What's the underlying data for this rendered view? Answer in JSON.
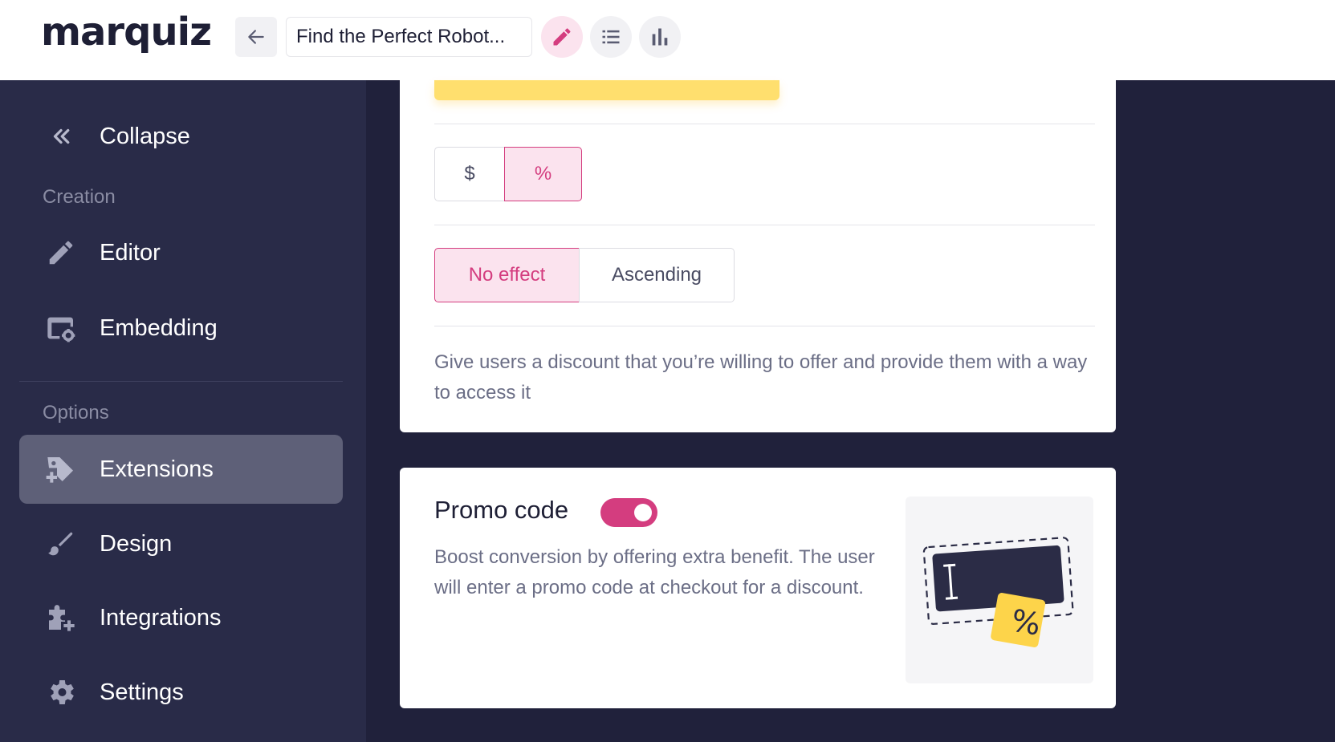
{
  "header": {
    "logo": "marquiz",
    "quiz_title": "Find the Perfect Robot..."
  },
  "sidebar": {
    "collapse_label": "Collapse",
    "section_creation": "Creation",
    "section_options": "Options",
    "items": [
      {
        "label": "Editor",
        "icon": "pencil-icon"
      },
      {
        "label": "Embedding",
        "icon": "embed-icon"
      },
      {
        "label": "Extensions",
        "icon": "tag-plus-icon",
        "active": true
      },
      {
        "label": "Design",
        "icon": "brush-icon"
      },
      {
        "label": "Integrations",
        "icon": "puzzle-plus-icon"
      },
      {
        "label": "Settings",
        "icon": "gear-icon"
      }
    ]
  },
  "discount": {
    "currency_options": [
      "$",
      "%"
    ],
    "currency_selected": "%",
    "effect_options": [
      "No effect",
      "Ascending"
    ],
    "effect_selected": "No effect",
    "description": "Give users a discount that you’re willing to offer and provide them with a way to access it"
  },
  "promo": {
    "title": "Promo code",
    "enabled": true,
    "description": "Boost conversion by offering extra benefit. The user will enter a promo code at checkout for a discount.",
    "illustration_badge": "%"
  },
  "colors": {
    "accent": "#d43d7f",
    "accent_light": "#fbe3ee",
    "sidebar_bg": "#292b48",
    "page_bg": "#20213b",
    "highlight_yellow": "#ffdf6e"
  }
}
